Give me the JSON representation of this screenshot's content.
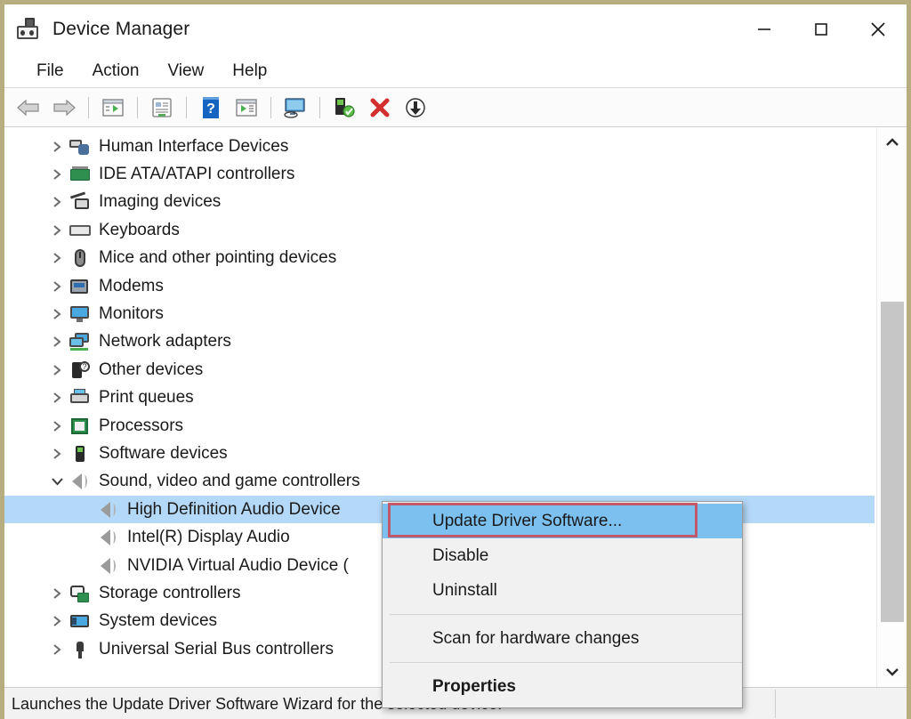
{
  "window": {
    "title": "Device Manager",
    "icon": "device-plug-icon",
    "controls": {
      "minimize": "—",
      "maximize": "□",
      "close": "✕"
    }
  },
  "menubar": {
    "items": [
      {
        "label": "File"
      },
      {
        "label": "Action"
      },
      {
        "label": "View"
      },
      {
        "label": "Help"
      }
    ]
  },
  "toolbar": {
    "buttons": [
      {
        "name": "back-icon"
      },
      {
        "name": "forward-icon"
      },
      {
        "name": "show-hidden-devices-icon"
      },
      {
        "name": "properties-icon"
      },
      {
        "name": "help-icon"
      },
      {
        "name": "scan-hardware-icon"
      },
      {
        "name": "update-driver-icon"
      },
      {
        "name": "disable-device-icon"
      },
      {
        "name": "uninstall-device-icon"
      },
      {
        "name": "download-icon"
      }
    ]
  },
  "tree": {
    "rows": [
      {
        "label": "Human Interface Devices",
        "depth": 0,
        "twisty": "collapsed",
        "icon": "hid-icon",
        "selected": false
      },
      {
        "label": "IDE ATA/ATAPI controllers",
        "depth": 0,
        "twisty": "collapsed",
        "icon": "ide-controller-icon",
        "selected": false
      },
      {
        "label": "Imaging devices",
        "depth": 0,
        "twisty": "collapsed",
        "icon": "camera-icon",
        "selected": false
      },
      {
        "label": "Keyboards",
        "depth": 0,
        "twisty": "collapsed",
        "icon": "keyboard-icon",
        "selected": false
      },
      {
        "label": "Mice and other pointing devices",
        "depth": 0,
        "twisty": "collapsed",
        "icon": "mouse-icon",
        "selected": false
      },
      {
        "label": "Modems",
        "depth": 0,
        "twisty": "collapsed",
        "icon": "modem-icon",
        "selected": false
      },
      {
        "label": "Monitors",
        "depth": 0,
        "twisty": "collapsed",
        "icon": "monitor-icon",
        "selected": false
      },
      {
        "label": "Network adapters",
        "depth": 0,
        "twisty": "collapsed",
        "icon": "network-adapter-icon",
        "selected": false
      },
      {
        "label": "Other devices",
        "depth": 0,
        "twisty": "collapsed",
        "icon": "unknown-device-icon",
        "selected": false
      },
      {
        "label": "Print queues",
        "depth": 0,
        "twisty": "collapsed",
        "icon": "printer-icon",
        "selected": false
      },
      {
        "label": "Processors",
        "depth": 0,
        "twisty": "collapsed",
        "icon": "processor-icon",
        "selected": false
      },
      {
        "label": "Software devices",
        "depth": 0,
        "twisty": "collapsed",
        "icon": "software-device-icon",
        "selected": false
      },
      {
        "label": "Sound, video and game controllers",
        "depth": 0,
        "twisty": "expanded",
        "icon": "speaker-icon",
        "selected": false
      },
      {
        "label": "High Definition Audio Device",
        "depth": 1,
        "twisty": "none",
        "icon": "speaker-icon",
        "selected": true
      },
      {
        "label": "Intel(R) Display Audio",
        "depth": 1,
        "twisty": "none",
        "icon": "speaker-icon",
        "selected": false
      },
      {
        "label": "NVIDIA Virtual Audio Device (",
        "depth": 1,
        "twisty": "none",
        "icon": "speaker-icon",
        "selected": false
      },
      {
        "label": "Storage controllers",
        "depth": 0,
        "twisty": "collapsed",
        "icon": "storage-controller-icon",
        "selected": false
      },
      {
        "label": "System devices",
        "depth": 0,
        "twisty": "collapsed",
        "icon": "system-device-icon",
        "selected": false
      },
      {
        "label": "Universal Serial Bus controllers",
        "depth": 0,
        "twisty": "collapsed",
        "icon": "usb-icon",
        "selected": false
      }
    ]
  },
  "context_menu": {
    "items": [
      {
        "label": "Update Driver Software...",
        "highlighted": true,
        "bold": false,
        "separator_after": false
      },
      {
        "label": "Disable",
        "highlighted": false,
        "bold": false,
        "separator_after": false
      },
      {
        "label": "Uninstall",
        "highlighted": false,
        "bold": false,
        "separator_after": true
      },
      {
        "label": "Scan for hardware changes",
        "highlighted": false,
        "bold": false,
        "separator_after": true
      },
      {
        "label": "Properties",
        "highlighted": false,
        "bold": true,
        "separator_after": false
      }
    ]
  },
  "statusbar": {
    "text": "Launches the Update Driver Software Wizard for the selected device."
  },
  "colors": {
    "selection_blue": "#b4d8f7",
    "menu_highlight_blue": "#7cc0f0",
    "annotation_red": "#c2596b",
    "window_border": "#b8ad7f"
  }
}
